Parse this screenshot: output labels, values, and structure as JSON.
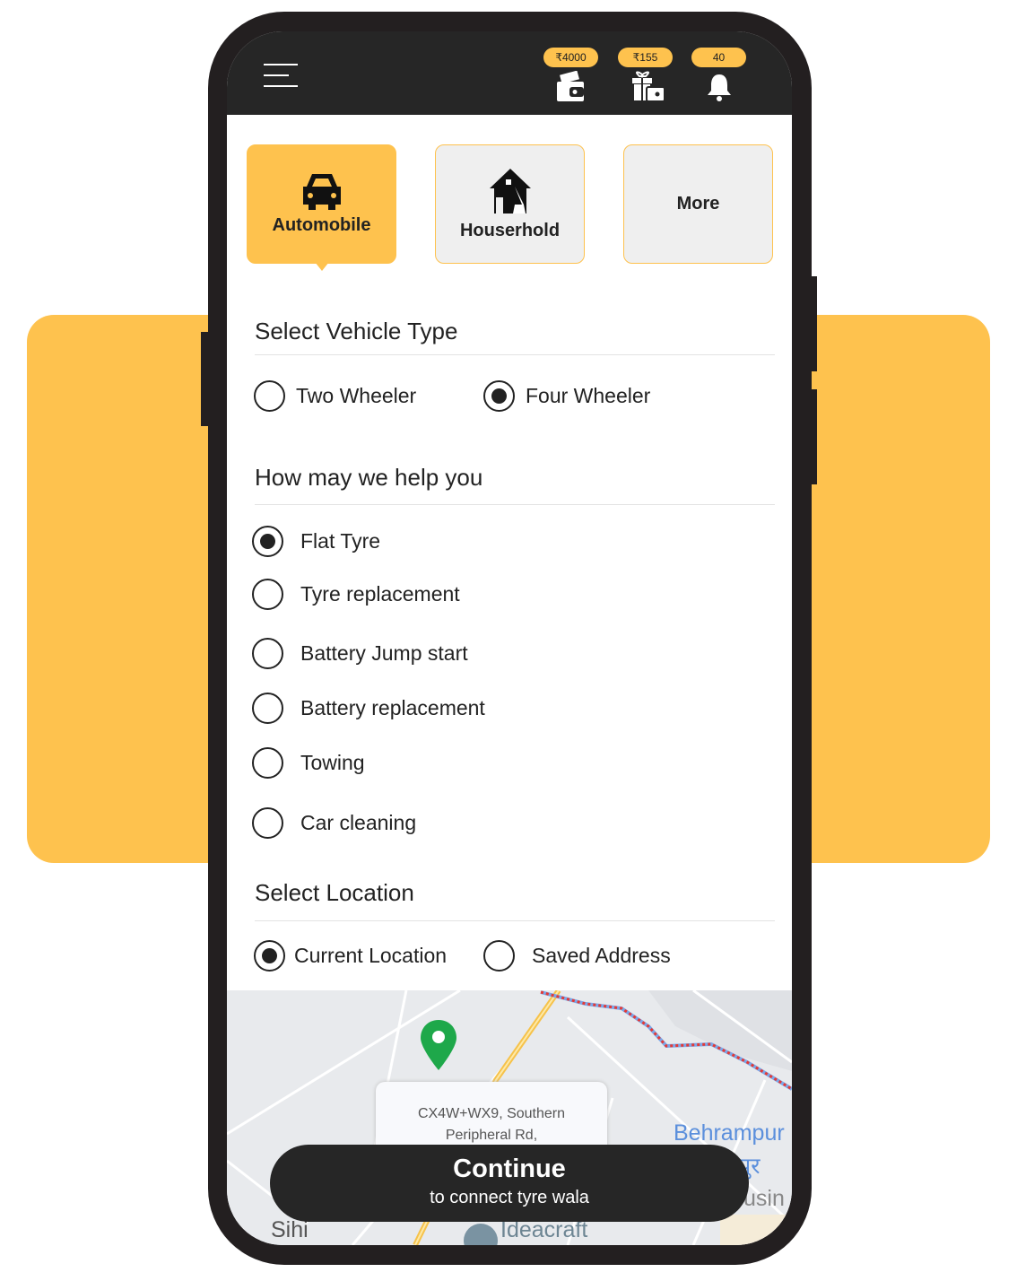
{
  "header": {
    "wallet_amount": "₹4000",
    "rewards_amount": "₹155",
    "notification_count": "40"
  },
  "categories": [
    {
      "label": "Automobile",
      "icon": "car-icon",
      "active": true
    },
    {
      "label": "Houserhold",
      "icon": "house-cleaning-icon",
      "active": false
    },
    {
      "label": "More",
      "active": false
    }
  ],
  "vehicle": {
    "title": "Select Vehicle Type",
    "options": [
      {
        "label": "Two Wheeler",
        "selected": false
      },
      {
        "label": "Four Wheeler",
        "selected": true
      }
    ]
  },
  "help": {
    "title": "How may we help you",
    "options": [
      {
        "label": "Flat Tyre",
        "selected": true
      },
      {
        "label": "Tyre replacement",
        "selected": false
      },
      {
        "label": "Battery Jump start",
        "selected": false
      },
      {
        "label": "Battery replacement",
        "selected": false
      },
      {
        "label": "Towing",
        "selected": false
      },
      {
        "label": "Car cleaning",
        "selected": false
      }
    ]
  },
  "location": {
    "title": "Select Location",
    "options": [
      {
        "label": "Current Location",
        "selected": true
      },
      {
        "label": "Saved Address",
        "selected": false
      }
    ]
  },
  "map": {
    "address_line1": "CX4W+WX9, Southern",
    "address_line2": "Peripheral Rd,",
    "labels": {
      "behrampur": "Behrampur",
      "behrampur_hindi": "पुर",
      "housing": "usin",
      "sihi": "Sihi",
      "ideacraft": "Ideacraft"
    }
  },
  "continue": {
    "title": "Continue",
    "subtitle": "to connect tyre wala"
  },
  "colors": {
    "accent": "#fec24e",
    "dark": "#262626",
    "pin": "#1ea84a"
  }
}
